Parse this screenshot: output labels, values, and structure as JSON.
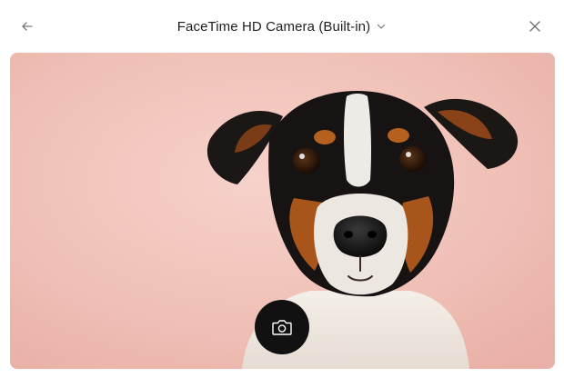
{
  "header": {
    "title": "FaceTime HD Camera (Built-in)",
    "back_icon": "arrow-left-icon",
    "dropdown_icon": "chevron-down-icon",
    "close_icon": "close-icon"
  },
  "preview": {
    "description_icon": "camera-preview-image",
    "background_color": "#f2c4bc"
  },
  "capture": {
    "icon": "camera-icon",
    "button_color": "#111111"
  }
}
